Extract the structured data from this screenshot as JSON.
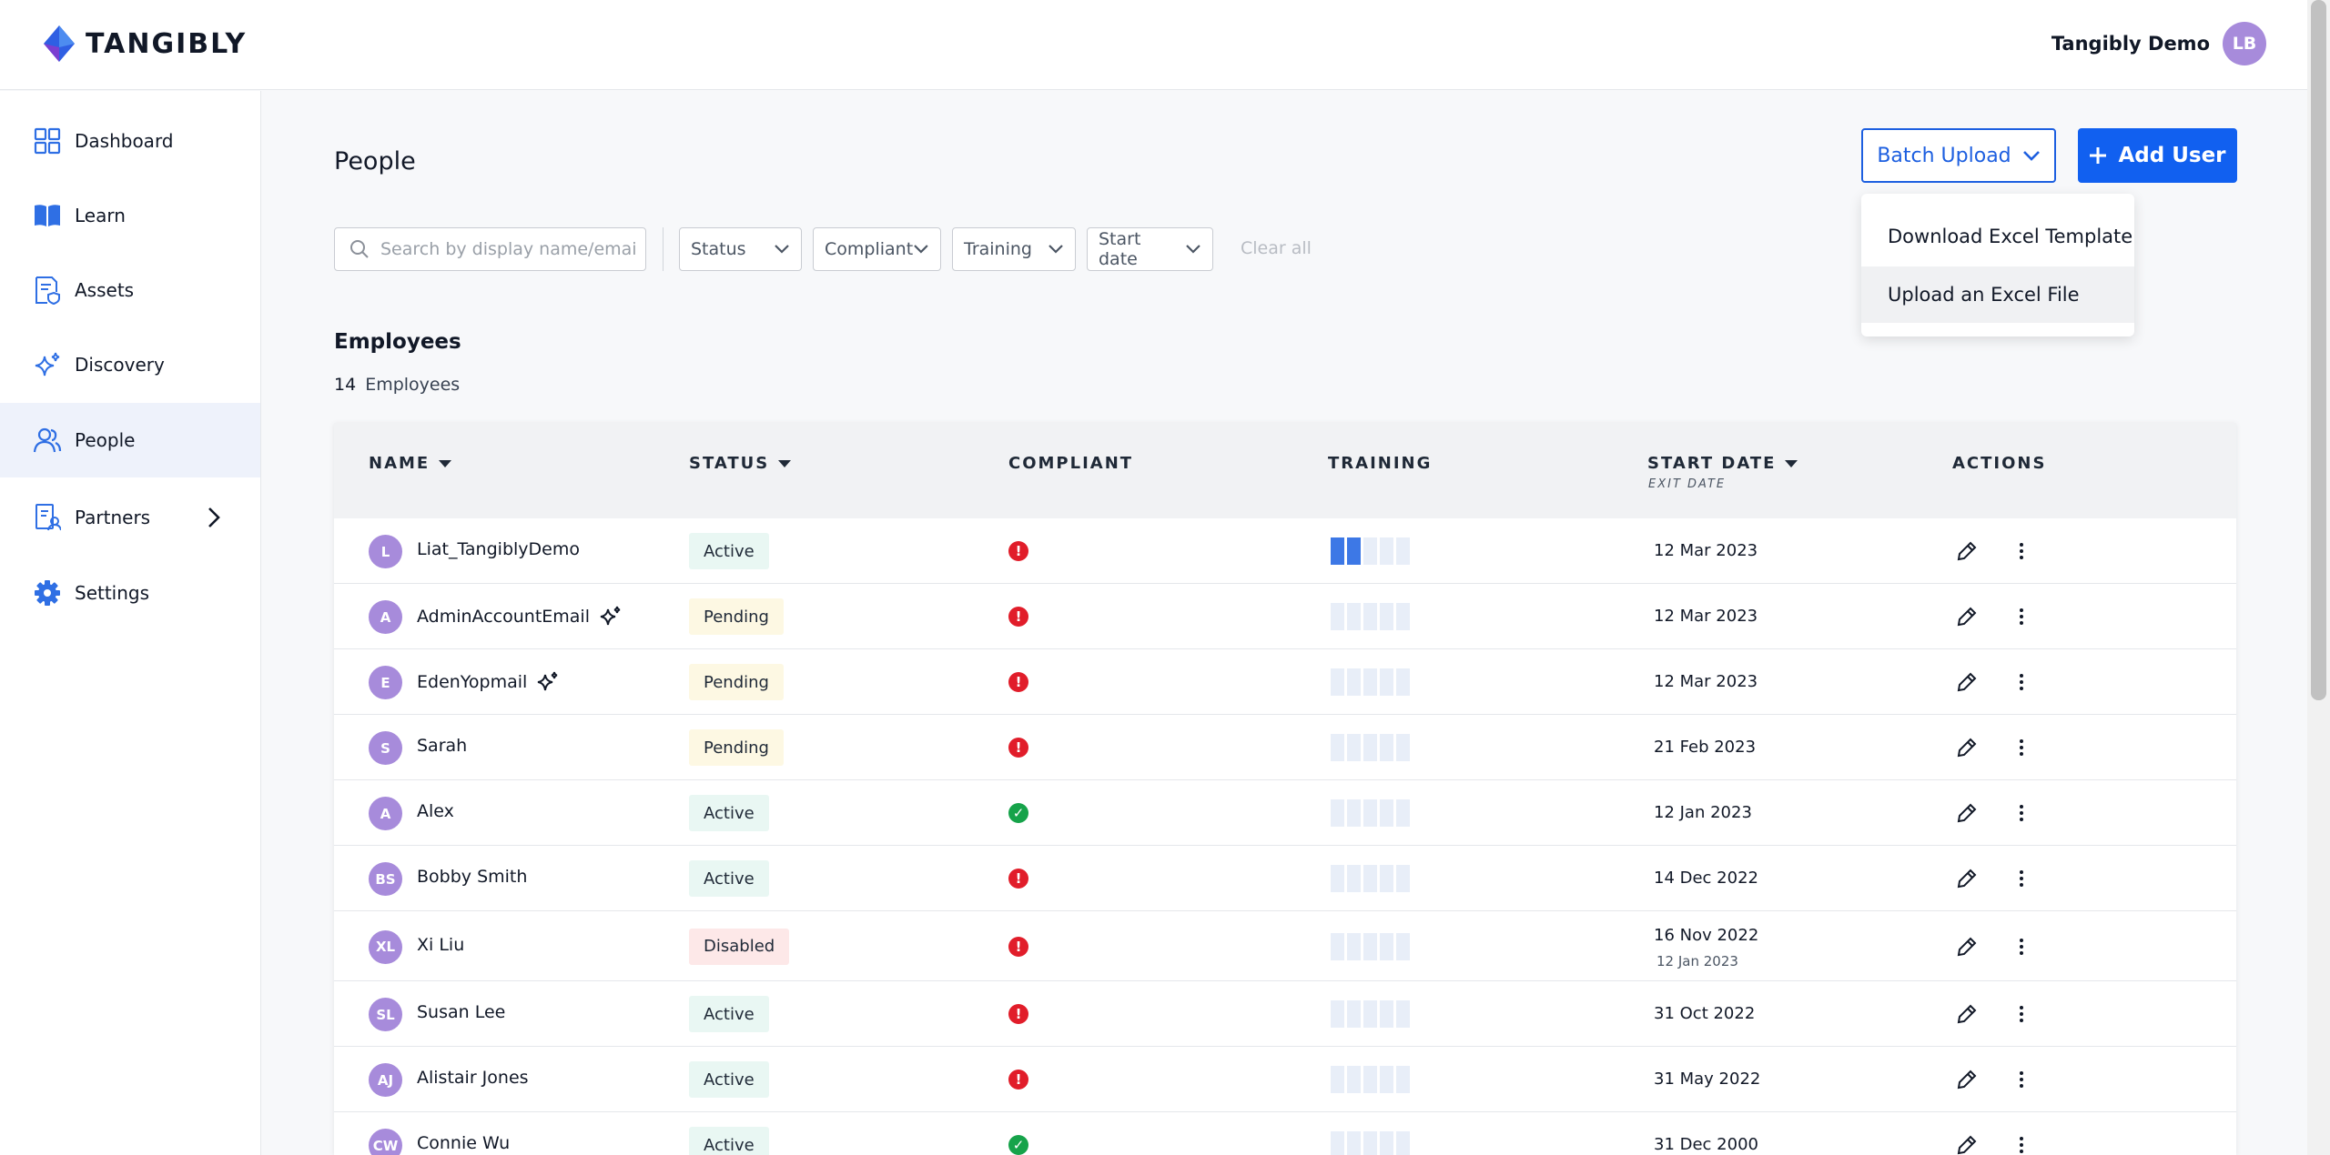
{
  "brand": {
    "name": "TANGIBLY"
  },
  "account": {
    "name": "Tangibly Demo",
    "initials": "LB"
  },
  "sidebar": {
    "items": [
      {
        "label": "Dashboard",
        "icon": "grid-icon"
      },
      {
        "label": "Learn",
        "icon": "book-icon"
      },
      {
        "label": "Assets",
        "icon": "document-shield-icon"
      },
      {
        "label": "Discovery",
        "icon": "sparkle-icon"
      },
      {
        "label": "People",
        "icon": "people-icon",
        "active": true
      },
      {
        "label": "Partners",
        "icon": "partner-icon"
      },
      {
        "label": "Settings",
        "icon": "gear-icon"
      }
    ]
  },
  "page": {
    "title": "People"
  },
  "toolbar": {
    "batch_upload": "Batch Upload",
    "add_user": "Add User"
  },
  "batch_menu": {
    "items": [
      "Download Excel Template",
      "Upload an Excel File"
    ]
  },
  "filters": {
    "search_placeholder": "Search by display name/email",
    "status": "Status",
    "compliant": "Compliant",
    "training": "Training",
    "start_date": "Start date",
    "clear_all": "Clear all"
  },
  "employees": {
    "title": "Employees",
    "count": "14",
    "count_label": "Employees",
    "columns": {
      "name": "NAME",
      "status": "STATUS",
      "compliant": "COMPLIANT",
      "training": "TRAINING",
      "start_date": "START DATE",
      "exit_date": "EXIT DATE",
      "actions": "ACTIONS"
    },
    "rows": [
      {
        "initials": "L",
        "name": "Liat_TangiblyDemo",
        "ai": false,
        "status": "Active",
        "compliant": false,
        "training": 0.4,
        "start": "12 Mar 2023",
        "exit": ""
      },
      {
        "initials": "A",
        "name": "AdminAccountEmail",
        "ai": true,
        "status": "Pending",
        "compliant": false,
        "training": 0,
        "start": "12 Mar 2023",
        "exit": ""
      },
      {
        "initials": "E",
        "name": "EdenYopmail",
        "ai": true,
        "status": "Pending",
        "compliant": false,
        "training": 0,
        "start": "12 Mar 2023",
        "exit": ""
      },
      {
        "initials": "S",
        "name": "Sarah",
        "ai": false,
        "status": "Pending",
        "compliant": false,
        "training": 0,
        "start": "21 Feb 2023",
        "exit": ""
      },
      {
        "initials": "A",
        "name": "Alex",
        "ai": false,
        "status": "Active",
        "compliant": true,
        "training": 0,
        "start": "12 Jan 2023",
        "exit": ""
      },
      {
        "initials": "BS",
        "name": "Bobby Smith",
        "ai": false,
        "status": "Active",
        "compliant": false,
        "training": 0,
        "start": "14 Dec 2022",
        "exit": ""
      },
      {
        "initials": "XL",
        "name": "Xi Liu",
        "ai": false,
        "status": "Disabled",
        "compliant": false,
        "training": 0,
        "start": "16 Nov 2022",
        "exit": "12 Jan 2023"
      },
      {
        "initials": "SL",
        "name": "Susan Lee",
        "ai": false,
        "status": "Active",
        "compliant": false,
        "training": 0,
        "start": "31 Oct 2022",
        "exit": ""
      },
      {
        "initials": "AJ",
        "name": "Alistair Jones",
        "ai": false,
        "status": "Active",
        "compliant": false,
        "training": 0,
        "start": "31 May 2022",
        "exit": ""
      },
      {
        "initials": "CW",
        "name": "Connie Wu",
        "ai": false,
        "status": "Active",
        "compliant": true,
        "training": 0,
        "start": "31 Dec 2000",
        "exit": ""
      }
    ]
  },
  "colors": {
    "primary": "#1160f0",
    "avatar": "#a78bdb",
    "noncompliant": "#e11d2a",
    "compliant": "#16a34a",
    "training_fill": "#3d78e6"
  }
}
